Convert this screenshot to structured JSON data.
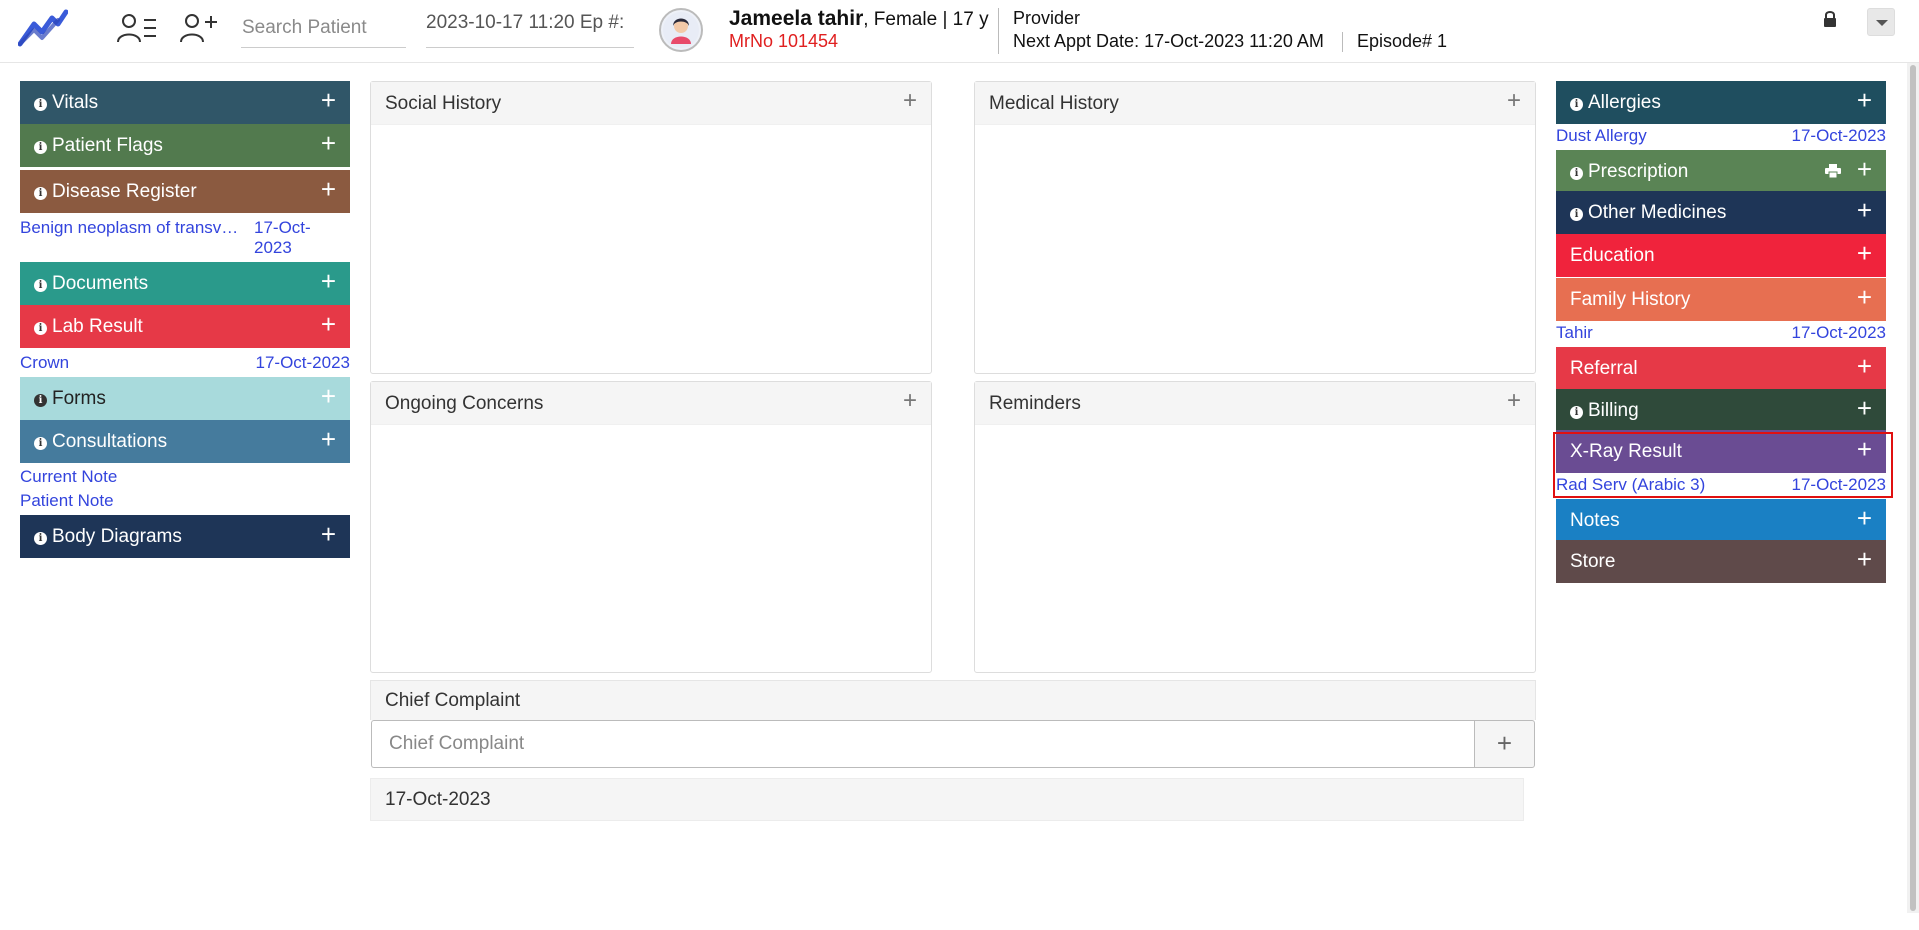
{
  "header": {
    "search_placeholder": "Search Patient",
    "episode_info": "2023-10-17 11:20 Ep #:",
    "patient_name": "Jameela tahir",
    "patient_details": ", Female | 17 y",
    "mrno": "MrNo 101454",
    "provider_label": "Provider",
    "next_appt": "Next Appt Date: 17-Oct-2023 11:20 AM",
    "episode": "Episode# 1"
  },
  "left_widgets": {
    "vitals": {
      "label": "Vitals",
      "color": "#305668"
    },
    "patient_flags": {
      "label": "Patient Flags",
      "color": "#527a4e"
    },
    "disease_register": {
      "label": "Disease Register",
      "color": "#8b5a40",
      "entry": "Benign neoplasm of transv…",
      "entry_date_1": "17-Oct-",
      "entry_date_2": "2023"
    },
    "documents": {
      "label": "Documents",
      "color": "#2a9a8b"
    },
    "lab_result": {
      "label": "Lab Result",
      "color": "#e63947",
      "entry": "Crown",
      "entry_date": "17-Oct-2023"
    },
    "forms": {
      "label": "Forms",
      "color": "#a8dadc"
    },
    "consultations": {
      "label": "Consultations",
      "color": "#457b9d",
      "entry_1": "Current Note",
      "entry_2": "Patient Note"
    },
    "body_diagrams": {
      "label": "Body Diagrams",
      "color": "#1e3557"
    }
  },
  "center": {
    "social_history": "Social History",
    "medical_history": "Medical History",
    "ongoing_concerns": "Ongoing Concerns",
    "reminders": "Reminders",
    "chief_complaint": "Chief Complaint",
    "chief_complaint_placeholder": "Chief Complaint",
    "cc_date": "17-Oct-2023"
  },
  "right_widgets": {
    "allergies": {
      "label": "Allergies",
      "color": "#1f4e5f",
      "entry": "Dust Allergy",
      "entry_date": "17-Oct-2023"
    },
    "prescription": {
      "label": "Prescription",
      "color": "#5a8455"
    },
    "other_medicines": {
      "label": "Other Medicines",
      "color": "#1e3557"
    },
    "education": {
      "label": "Education",
      "color": "#f0233c"
    },
    "family_history": {
      "label": "Family History",
      "color": "#e76f51",
      "entry": "Tahir",
      "entry_date": "17-Oct-2023"
    },
    "referral": {
      "label": "Referral",
      "color": "#e63947"
    },
    "billing": {
      "label": "Billing",
      "color": "#2f4a3a"
    },
    "xray_result": {
      "label": "X-Ray Result",
      "color": "#6a4c93",
      "entry": "Rad Serv (Arabic 3)",
      "entry_date": "17-Oct-2023"
    },
    "notes": {
      "label": "Notes",
      "color": "#1a80c4"
    },
    "store": {
      "label": "Store",
      "color": "#5f4a4a"
    }
  },
  "icons": {
    "plus": "+",
    "info": "i"
  }
}
